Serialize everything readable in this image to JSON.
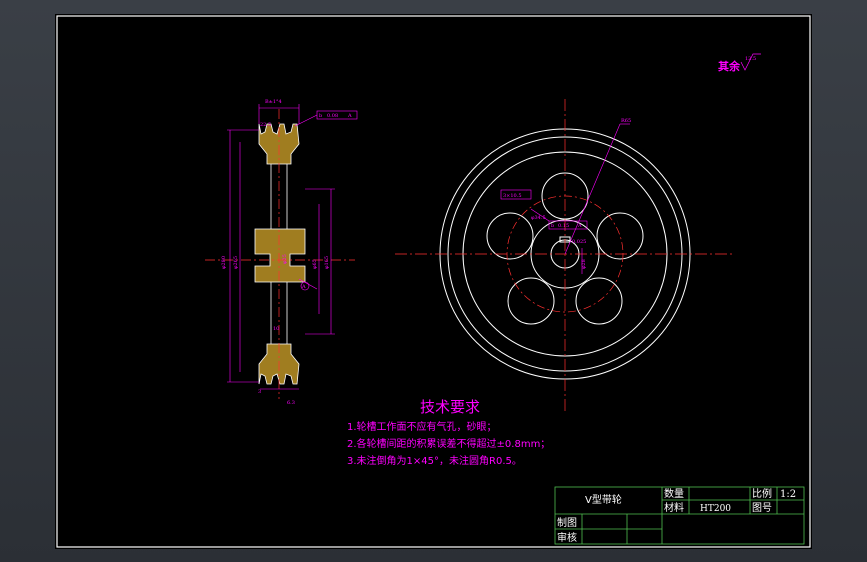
{
  "drawing": {
    "surface_note": "其余",
    "surface_value": "12.5",
    "side_view_labels": [
      "B±1°4",
      "22.5",
      "b",
      "0.08",
      "A",
      "φ280",
      "φ265",
      "φ25",
      "φ65",
      "φ165",
      "10",
      "A",
      "3",
      "6.3"
    ],
    "front_view_labels": [
      "3×10.5",
      "b",
      "0.15",
      "A",
      "0.025",
      "φ28",
      "φ34.5",
      "R65"
    ]
  },
  "requirements": {
    "title": "技术要求",
    "items": [
      "1.轮槽工作面不应有气孔，砂眼；",
      "2.各轮槽间距的积累误差不得超过±0.8mm；",
      "3.未注倒角为1×45°，未注圆角R0.5。"
    ]
  },
  "title_block": {
    "part_name": "V型带轮",
    "quantity_label": "数量",
    "quantity_value": "",
    "scale_label": "比例",
    "scale_value": "1:2",
    "material_label": "材料",
    "material_value": "HT200",
    "drawing_no_label": "图号",
    "drawing_no_value": "",
    "drawn_label": "制图",
    "checked_label": "审核"
  },
  "colors": {
    "line": "#ffffff",
    "dimension": "#ff00ff",
    "section_fill": "#a07d20",
    "centerline": "#ff3030",
    "table_line": "#4fbf4f"
  }
}
